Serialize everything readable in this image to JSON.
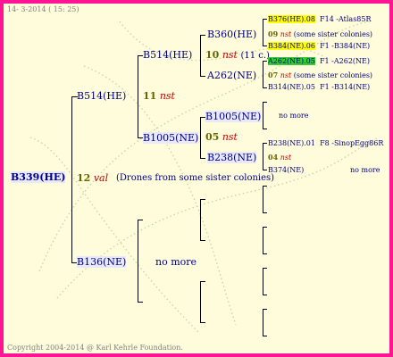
{
  "header": {
    "date": "14-  3-2014 ( 15: 25)"
  },
  "footer": {
    "copyright": "Copyright 2004-2014 @ Karl Kehrle Foundation."
  },
  "root": {
    "label": "B339(HE)"
  },
  "gen1": {
    "sire": {
      "label": "B514(HE)"
    },
    "dam_line": {
      "num": "12",
      "type": "val",
      "note": "(Drones from some sister colonies)"
    },
    "dam": {
      "label": "B136(NE)",
      "nomore": "no more"
    }
  },
  "gen2": {
    "sire_sire": {
      "label": "B514(HE)"
    },
    "sire_line": {
      "num": "11",
      "type": "nst"
    },
    "sire_dam": {
      "label": "B1005(NE)"
    }
  },
  "gen3": {
    "a": {
      "label": "B360(HE)"
    },
    "a_line": {
      "num": "10",
      "type": "nst",
      "count": "(11 c.)"
    },
    "b": {
      "label": "A262(NE)"
    },
    "c": {
      "label": "B1005(NE)"
    },
    "c_line": {
      "num": "05",
      "type": "nst"
    },
    "d": {
      "label": "B238(NE)"
    }
  },
  "gen4": {
    "r1": {
      "id": "B376(HE)",
      "num": ".08",
      "name": "F14 -Atlas85R"
    },
    "r2": {
      "num": "09",
      "type": "nst",
      "note": "(some sister colonies)"
    },
    "r3": {
      "id": "B384(NE)",
      "num": ".06",
      "name": "F1 -B384(NE)"
    },
    "r4": {
      "id": "A262(NE)",
      "num": ".05",
      "name": "F1 -A262(NE)"
    },
    "r5": {
      "num": "07",
      "type": "nst",
      "note": "(some sister colonies)"
    },
    "r6": {
      "id": "B314(NE)",
      "num": ".05",
      "name": "F1 -B314(NE)"
    },
    "r7": {
      "nomore": "no more"
    },
    "r8": {
      "id": "B238(NE)",
      "num": ".01",
      "name": "F8 -SinopEgg86R"
    },
    "r9": {
      "num": "04",
      "type": "nst"
    },
    "r10": {
      "id": "B374(NE)",
      "nomore": "no more"
    }
  },
  "colors": {
    "border": "#ff1493",
    "background": "#fffcdc",
    "text": "#000080",
    "highlight_yellow": "#ffff00",
    "highlight_green": "#33cc33",
    "pedigree_red": "#cc0000"
  }
}
